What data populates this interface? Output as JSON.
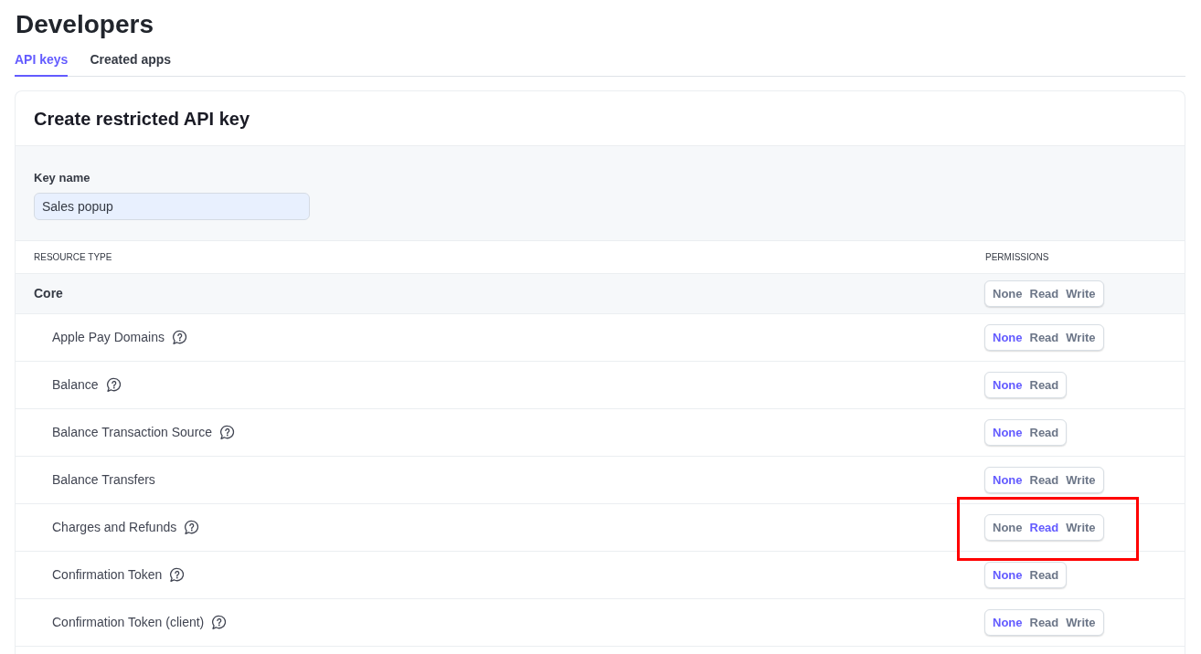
{
  "page_title": "Developers",
  "tabs": [
    {
      "label": "API keys",
      "selected": true
    },
    {
      "label": "Created apps",
      "selected": false
    }
  ],
  "card": {
    "title": "Create restricted API key",
    "key_name": {
      "label": "Key name",
      "value": "Sales popup"
    },
    "table": {
      "columns": [
        "RESOURCE TYPE",
        "PERMISSIONS"
      ],
      "rows": [
        {
          "kind": "group",
          "name": "Core",
          "help": false,
          "highlighted": false,
          "options": [
            {
              "label": "None",
              "selected": false
            },
            {
              "label": "Read",
              "selected": false
            },
            {
              "label": "Write",
              "selected": false
            }
          ]
        },
        {
          "kind": "resource",
          "name": "Apple Pay Domains",
          "help": true,
          "highlighted": false,
          "options": [
            {
              "label": "None",
              "selected": true
            },
            {
              "label": "Read",
              "selected": false
            },
            {
              "label": "Write",
              "selected": false
            }
          ]
        },
        {
          "kind": "resource",
          "name": "Balance",
          "help": true,
          "highlighted": false,
          "options": [
            {
              "label": "None",
              "selected": true
            },
            {
              "label": "Read",
              "selected": false
            }
          ]
        },
        {
          "kind": "resource",
          "name": "Balance Transaction Source",
          "help": true,
          "highlighted": false,
          "options": [
            {
              "label": "None",
              "selected": true
            },
            {
              "label": "Read",
              "selected": false
            }
          ]
        },
        {
          "kind": "resource",
          "name": "Balance Transfers",
          "help": false,
          "highlighted": false,
          "options": [
            {
              "label": "None",
              "selected": true
            },
            {
              "label": "Read",
              "selected": false
            },
            {
              "label": "Write",
              "selected": false
            }
          ]
        },
        {
          "kind": "resource",
          "name": "Charges and Refunds",
          "help": true,
          "highlighted": true,
          "options": [
            {
              "label": "None",
              "selected": false
            },
            {
              "label": "Read",
              "selected": true
            },
            {
              "label": "Write",
              "selected": false
            }
          ]
        },
        {
          "kind": "resource",
          "name": "Confirmation Token",
          "help": true,
          "highlighted": false,
          "options": [
            {
              "label": "None",
              "selected": true
            },
            {
              "label": "Read",
              "selected": false
            }
          ]
        },
        {
          "kind": "resource",
          "name": "Confirmation Token (client)",
          "help": true,
          "highlighted": false,
          "options": [
            {
              "label": "None",
              "selected": true
            },
            {
              "label": "Read",
              "selected": false
            },
            {
              "label": "Write",
              "selected": false
            }
          ]
        }
      ]
    }
  }
}
